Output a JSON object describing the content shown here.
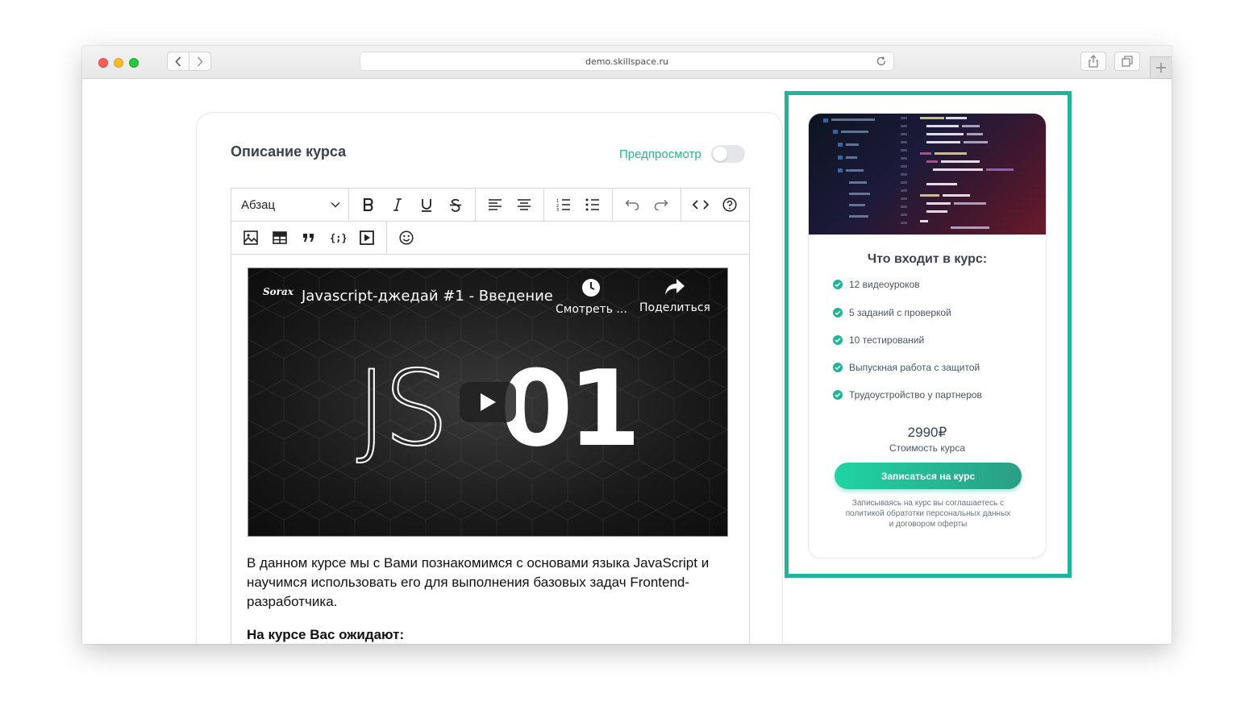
{
  "browser": {
    "url": "demo.skillspace.ru"
  },
  "editor": {
    "title": "Описание курса",
    "preview_label": "Предпросмотр",
    "paragraph_select": "Абзац",
    "video": {
      "channel_logo": "Sorax",
      "title": "Javascript-джедай #1 - Введение",
      "watch_later": "Смотреть ...",
      "share": "Поделиться",
      "thumb_js": "JS",
      "thumb_num": "01"
    },
    "body_text": "В данном курсе мы с Вами познакомимся с основами языка JavaScript и научимся использовать его для выполнения базовых задач Frontend-разработчика.",
    "body_subheading": "На курсе Вас ожидают:"
  },
  "sidebar": {
    "heading": "Что входит в курс:",
    "features": [
      "12 видеоуроков",
      "5 заданий с проверкой",
      "10 тестирований",
      "Выпускная работа с защитой",
      "Трудоустройство у партнеров"
    ],
    "price": "2990₽",
    "price_label": "Стоимость курса",
    "enroll_button": "Записаться на курс",
    "terms_line1": "Записываясь на курс вы соглашаетесь с политикой обратотки персональных данных",
    "terms_line2": "и договором оферты"
  },
  "colors": {
    "accent": "#1fb59a",
    "heading": "#3a4250"
  }
}
